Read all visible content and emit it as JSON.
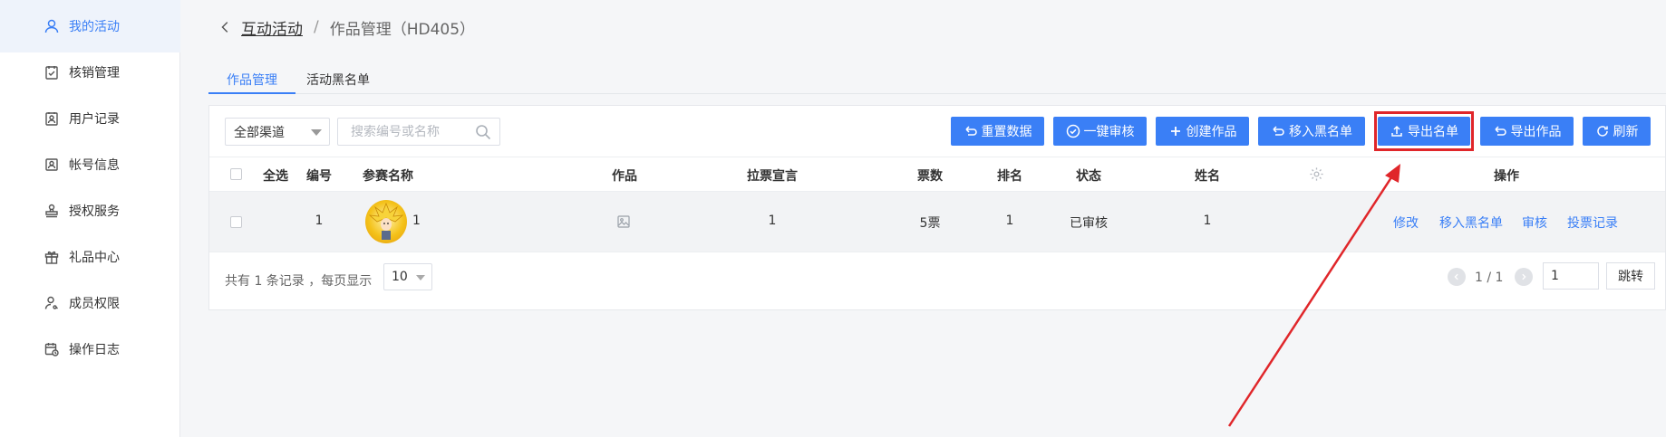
{
  "sidebar": {
    "items": [
      {
        "label": "我的活动",
        "icon": "user-icon",
        "active": true
      },
      {
        "label": "核销管理",
        "icon": "check-clipboard-icon"
      },
      {
        "label": "用户记录",
        "icon": "user-card-icon"
      },
      {
        "label": "帐号信息",
        "icon": "id-card-icon"
      },
      {
        "label": "授权服务",
        "icon": "stamp-icon"
      },
      {
        "label": "礼品中心",
        "icon": "gift-icon"
      },
      {
        "label": "成员权限",
        "icon": "user-key-icon"
      },
      {
        "label": "操作日志",
        "icon": "calendar-log-icon"
      }
    ]
  },
  "breadcrumb": {
    "parent": "互动活动",
    "separator": "/",
    "current": "作品管理（HD405）"
  },
  "tabs": [
    {
      "label": "作品管理",
      "active": true
    },
    {
      "label": "活动黑名单",
      "active": false
    }
  ],
  "toolbar": {
    "channel_select": "全部渠道",
    "search_placeholder": "搜索编号或名称",
    "buttons": {
      "reset": "重置数据",
      "approve_all": "一键审核",
      "create": "创建作品",
      "move_blacklist": "移入黑名单",
      "export_names": "导出名单",
      "export_works": "导出作品",
      "refresh": "刷新"
    }
  },
  "table": {
    "headers": {
      "select_all": "全选",
      "id": "编号",
      "name": "参赛名称",
      "work": "作品",
      "slogan": "拉票宣言",
      "votes": "票数",
      "rank": "排名",
      "status": "状态",
      "fullname": "姓名",
      "ops": "操作"
    },
    "rows": [
      {
        "id": "1",
        "name": "1",
        "slogan": "1",
        "votes": "5票",
        "rank": "1",
        "status": "已审核",
        "fullname": "1",
        "actions": {
          "edit": "修改",
          "blacklist": "移入黑名单",
          "review": "审核",
          "vote_log": "投票记录"
        }
      }
    ]
  },
  "footer": {
    "total_text": "共有 1 条记录 ，每页显示",
    "page_size": "10",
    "page_info": "1 / 1",
    "page_input": "1",
    "jump_label": "跳转"
  },
  "colors": {
    "primary": "#3a7ff6",
    "highlight": "#e0262a",
    "annotation_arrow": "#e0262a"
  }
}
